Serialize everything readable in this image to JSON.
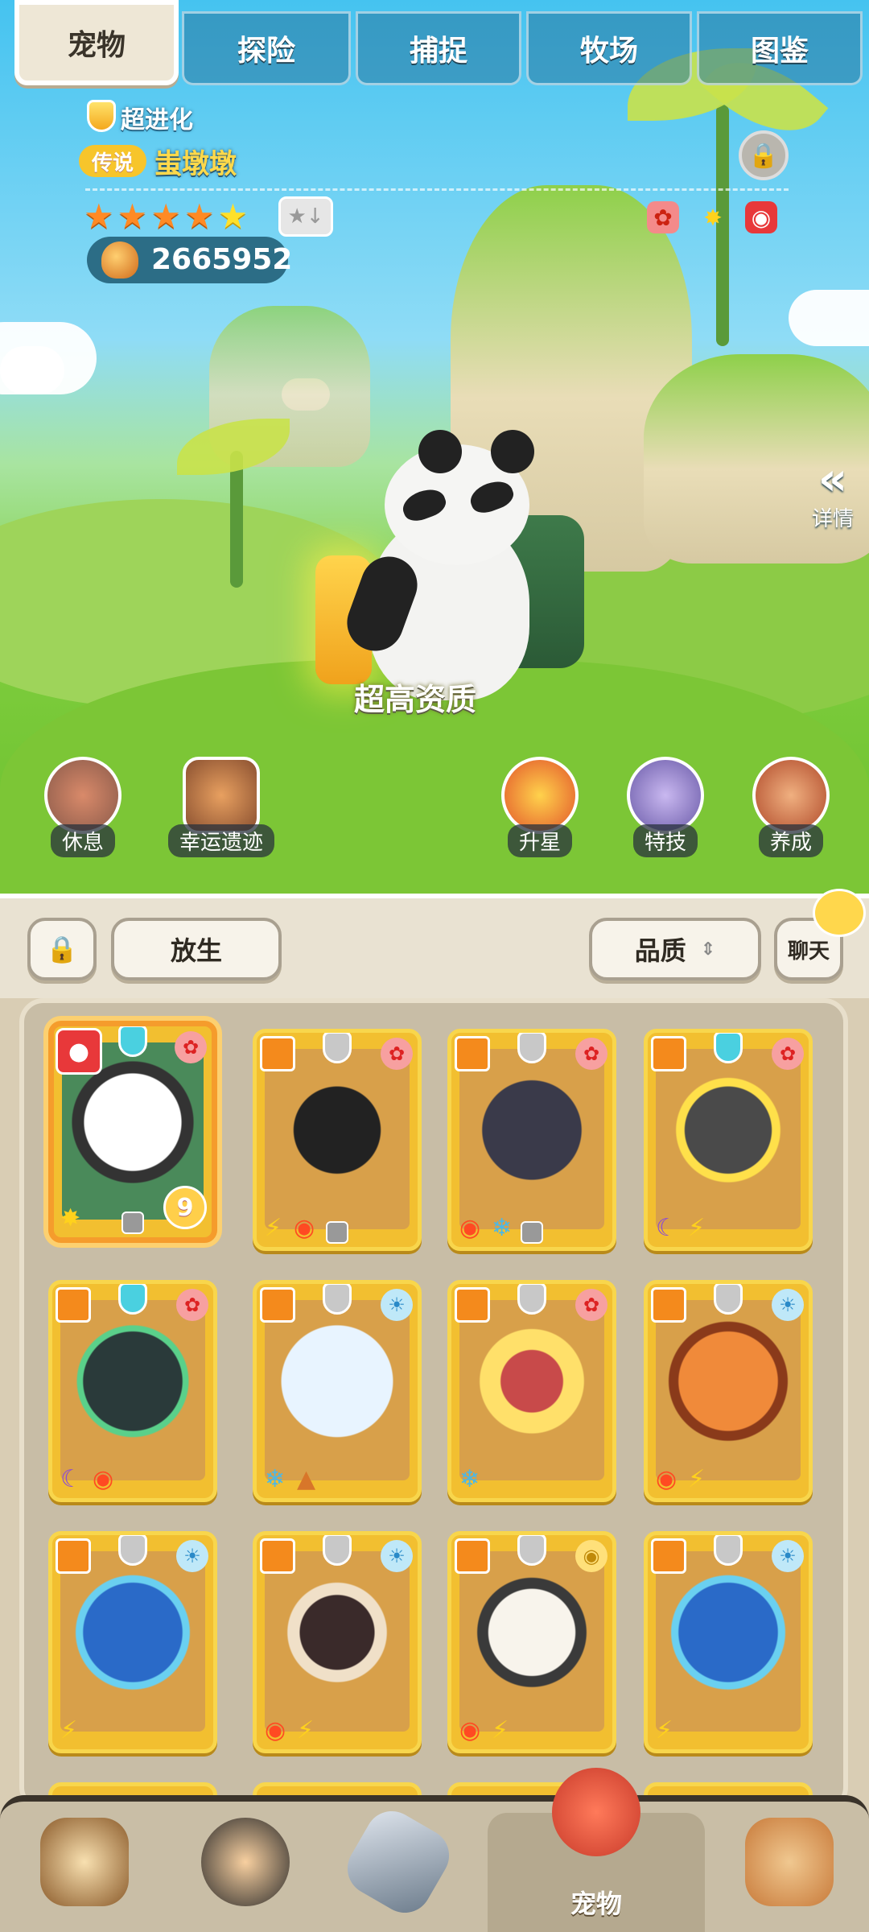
{
  "tabs": [
    "宠物",
    "探险",
    "捕捉",
    "牧场",
    "图鉴"
  ],
  "pet": {
    "rank": "超进化",
    "tier": "传说",
    "name": "蚩墩墩",
    "power": "2665952",
    "quality": "超高资质",
    "stars": 5
  },
  "details_label": "详情",
  "actions": {
    "rest": "休息",
    "lucky_ruins": "幸运遗迹",
    "star_up": "升星",
    "skill": "特技",
    "cultivate": "养成"
  },
  "toolbar": {
    "release": "放生",
    "quality_sort": "品质",
    "chat": "聊天"
  },
  "selected_pet_level": "9",
  "bottom_nav": {
    "active_label": "宠物"
  },
  "colors": {
    "card_gold": "#f2bf30",
    "selected_border": "#f59c2c",
    "fire": "#ff4a22",
    "ice": "#4ab8e8",
    "electric": "#ffd21c",
    "dark": "#8a4ad8"
  }
}
